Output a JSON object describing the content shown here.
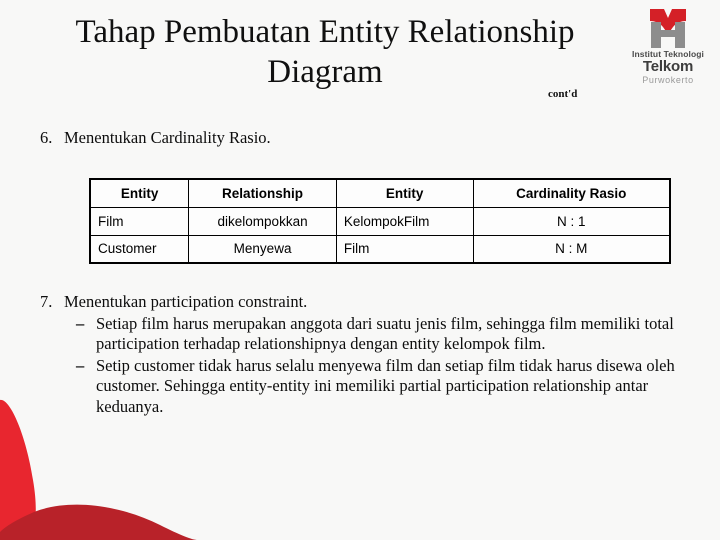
{
  "slide": {
    "title": "Tahap Pembuatan Entity Relationship Diagram",
    "title_contd": "cont'd",
    "background_color": "#f8f8f7"
  },
  "logo": {
    "name": "telkom-logo",
    "line1": "Institut Teknologi",
    "line2": "Telkom",
    "line3": "Purwokerto",
    "mark_red": "#d42027",
    "mark_gray": "#8d8d8d"
  },
  "content": {
    "item6": {
      "number": "6.",
      "text": "Menentukan Cardinality Rasio."
    },
    "item7": {
      "number": "7.",
      "text": "Menentukan participation constraint.",
      "bullets": [
        {
          "marker": "–",
          "text": "Setiap film harus merupakan anggota dari suatu jenis film, sehingga film memiliki total participation terhadap relationshipnya dengan entity kelompok film."
        },
        {
          "marker": "–",
          "text": "Setip customer tidak harus selalu menyewa film dan setiap film tidak harus disewa oleh customer. Sehingga entity-entity ini memiliki partial participation relationship antar keduanya."
        }
      ]
    }
  },
  "table": {
    "headers": [
      "Entity",
      "Relationship",
      "Entity",
      "Cardinality Rasio"
    ],
    "rows": [
      [
        "Film",
        "dikelompokkan",
        "KelompokFilm",
        "N : 1"
      ],
      [
        "Customer",
        "Menyewa",
        "Film",
        "N : M"
      ]
    ]
  },
  "decoration": {
    "red_bright": "#e8262f",
    "red_dark": "#b82229"
  }
}
